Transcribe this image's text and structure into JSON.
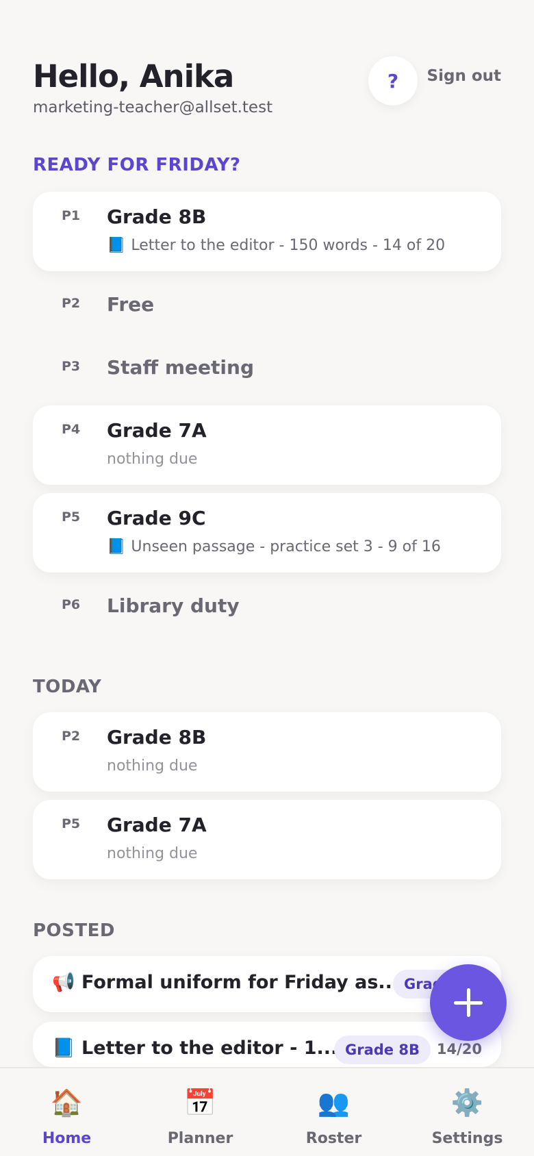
{
  "header": {
    "greeting": "Hello, Anika",
    "email": "marketing-teacher@allset.test",
    "help_label": "?",
    "signout_label": "Sign out"
  },
  "ready": {
    "title": "READY FOR FRIDAY?",
    "rows": [
      {
        "period": "P1",
        "cls": "Grade 8B",
        "sub": "Letter to the editor - 150 words - 14 of 20",
        "icon": "📘"
      },
      {
        "period": "P2",
        "cls": "Free"
      },
      {
        "period": "P3",
        "cls": "Staff meeting"
      },
      {
        "period": "P4",
        "cls": "Grade 7A",
        "sub": "nothing due"
      },
      {
        "period": "P5",
        "cls": "Grade 9C",
        "sub": "Unseen passage - practice set 3 - 9 of 16",
        "icon": "📘"
      },
      {
        "period": "P6",
        "cls": "Library duty"
      }
    ]
  },
  "today": {
    "title": "TODAY",
    "rows": [
      {
        "period": "P2",
        "cls": "Grade 8B",
        "sub": "nothing due"
      },
      {
        "period": "P5",
        "cls": "Grade 7A",
        "sub": "nothing due"
      }
    ]
  },
  "posted": {
    "title": "POSTED",
    "items": [
      {
        "icon": "📢",
        "title": "Formal uniform for Friday as...",
        "chip": "Grade 8B"
      },
      {
        "icon": "📘",
        "title": "Letter to the editor - 1...",
        "chip": "Grade 8B",
        "count": "14/20"
      }
    ]
  },
  "fab": {
    "icon": "plus-icon"
  },
  "tabs": [
    {
      "icon": "🏠",
      "label": "Home",
      "active": true
    },
    {
      "icon": "📅",
      "label": "Planner"
    },
    {
      "icon": "👥",
      "label": "Roster"
    },
    {
      "icon": "⚙️",
      "label": "Settings"
    }
  ],
  "colors": {
    "accent": "#5b46d0",
    "fab": "#6a56e0",
    "background": "#f8f7f5"
  }
}
